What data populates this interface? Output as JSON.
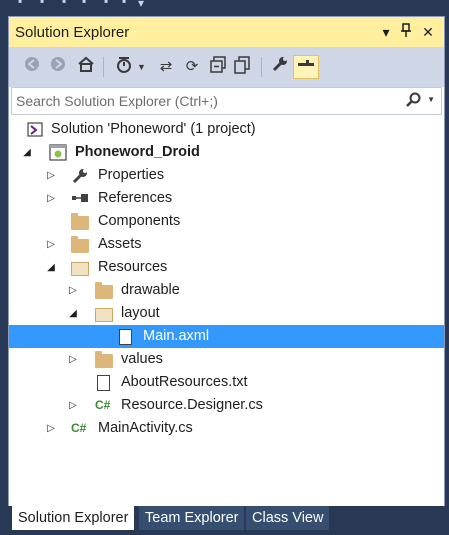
{
  "window": {
    "title": "Solution Explorer"
  },
  "title_buttons": [
    {
      "name": "dropdown-caret-icon",
      "glyph": "▾"
    },
    {
      "name": "pin-icon",
      "glyph": "⊣"
    },
    {
      "name": "close-icon",
      "glyph": "✕"
    }
  ],
  "toolbar": {
    "icons": [
      "back-icon",
      "forward-icon",
      "home-icon",
      "pending-changes-filter-icon",
      "sync-with-active-document-icon",
      "refresh-icon",
      "collapse-all-icon",
      "show-all-files-icon",
      "properties-icon",
      "preview-selected-items-icon"
    ]
  },
  "search": {
    "placeholder": "Search Solution Explorer (Ctrl+;)"
  },
  "tree": [
    {
      "label": "Solution 'Phoneword' (1 project)",
      "icon": "solution-icon",
      "expander": "none"
    },
    {
      "label": "Phoneword_Droid",
      "icon": "project-icon",
      "expander": "expanded"
    },
    {
      "label": "Properties",
      "icon": "wrench-icon",
      "expander": "collapsed"
    },
    {
      "label": "References",
      "icon": "references-icon",
      "expander": "collapsed"
    },
    {
      "label": "Components",
      "icon": "folder-icon",
      "expander": "none"
    },
    {
      "label": "Assets",
      "icon": "folder-icon",
      "expander": "collapsed"
    },
    {
      "label": "Resources",
      "icon": "folder-open-icon",
      "expander": "expanded"
    },
    {
      "label": "drawable",
      "icon": "folder-icon",
      "expander": "collapsed"
    },
    {
      "label": "layout",
      "icon": "folder-open-icon",
      "expander": "expanded"
    },
    {
      "label": "Main.axml",
      "icon": "file-icon",
      "expander": "none",
      "selected": true
    },
    {
      "label": "values",
      "icon": "folder-icon",
      "expander": "collapsed"
    },
    {
      "label": "AboutResources.txt",
      "icon": "file-icon",
      "expander": "none"
    },
    {
      "label": "Resource.Designer.cs",
      "icon": "csharp-file-icon",
      "expander": "collapsed"
    },
    {
      "label": "MainActivity.cs",
      "icon": "csharp-file-icon",
      "expander": "collapsed"
    }
  ],
  "bottom_tabs": [
    "Solution Explorer",
    "Team Explorer",
    "Class View"
  ],
  "colors": {
    "selection": "#3399ff",
    "title_active": "#ffef9e",
    "toolbar": "#cfd6e5",
    "chrome": "#293955"
  }
}
